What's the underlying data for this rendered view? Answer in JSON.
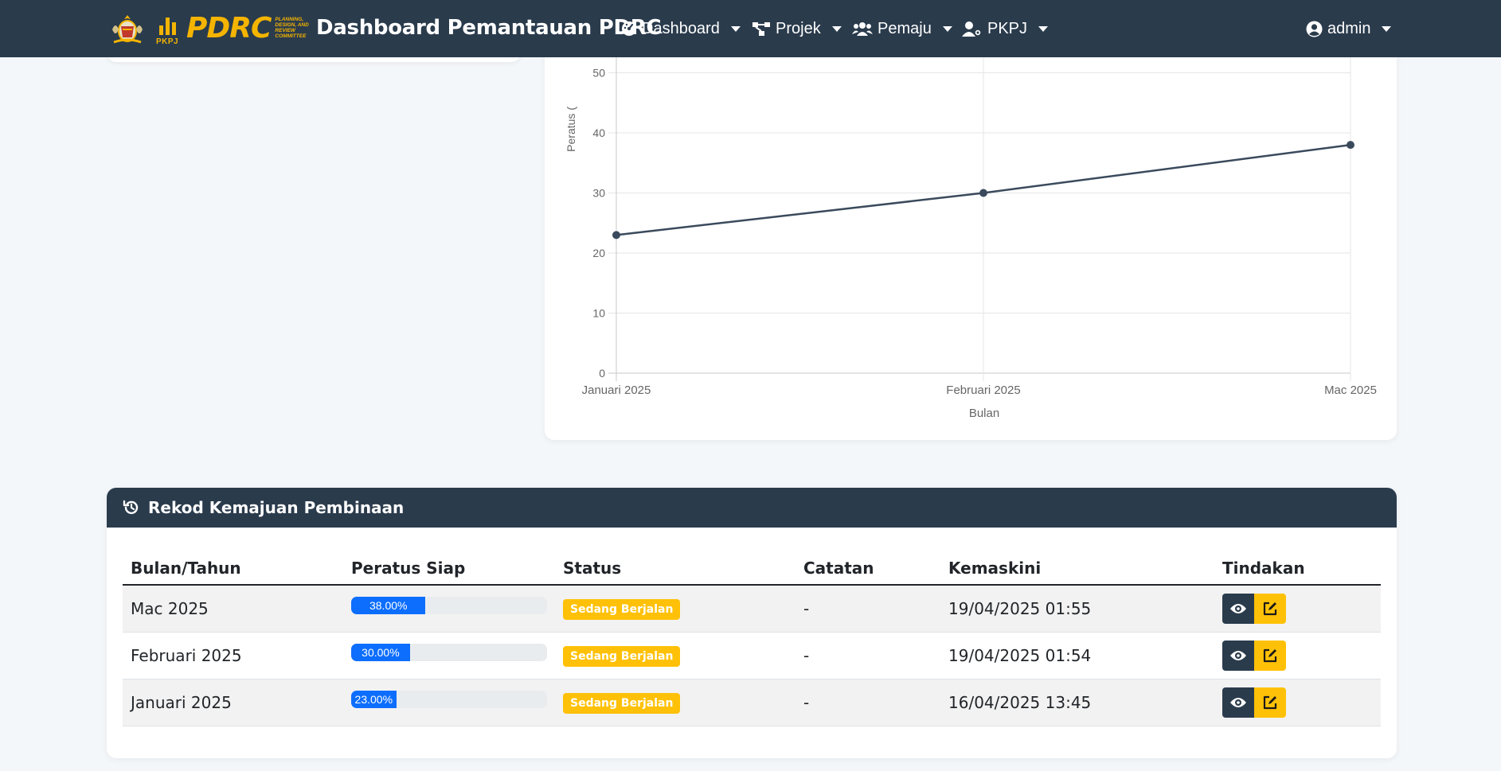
{
  "navbar": {
    "logo_pkpj": "PKPJ",
    "logo_pdrc": "PDRC",
    "logo_pdrc_sub": "PLANNING, DESIGN, AND REVIEW COMMITTEE",
    "title": "Dashboard Pemantauan PDRC",
    "menu": [
      {
        "label": "Dashboard",
        "icon": "gauge-icon"
      },
      {
        "label": "Projek",
        "icon": "project-diagram-icon"
      },
      {
        "label": "Pemaju",
        "icon": "users-icon"
      },
      {
        "label": "PKPJ",
        "icon": "user-gear-icon"
      }
    ],
    "user": {
      "label": "admin",
      "icon": "user-circle-icon"
    }
  },
  "chart_data": {
    "type": "line",
    "categories": [
      "Januari 2025",
      "Februari 2025",
      "Mac 2025"
    ],
    "values": [
      23,
      30,
      38
    ],
    "xlabel": "Bulan",
    "ylabel": "Peratus (",
    "y_ticks": [
      "0",
      "10",
      "20",
      "30",
      "40",
      "50"
    ],
    "ylim": [
      0,
      50
    ],
    "grid": true,
    "line_color": "#3a4a5c"
  },
  "records": {
    "title": "Rekod Kemajuan Pembinaan",
    "icon": "history-icon",
    "columns": [
      "Bulan/Tahun",
      "Peratus Siap",
      "Status",
      "Catatan",
      "Kemaskini",
      "Tindakan"
    ],
    "rows": [
      {
        "month": "Mac 2025",
        "percent": 38,
        "percent_label": "38.00%",
        "status": "Sedang Berjalan",
        "note": "-",
        "updated": "19/04/2025 01:55"
      },
      {
        "month": "Februari 2025",
        "percent": 30,
        "percent_label": "30.00%",
        "status": "Sedang Berjalan",
        "note": "-",
        "updated": "19/04/2025 01:54"
      },
      {
        "month": "Januari 2025",
        "percent": 23,
        "percent_label": "23.00%",
        "status": "Sedang Berjalan",
        "note": "-",
        "updated": "16/04/2025 13:45"
      }
    ]
  },
  "colors": {
    "navbar": "#2a3b4c",
    "accent": "#f4b400",
    "progress": "#0d6efd",
    "badge": "#ffc107"
  }
}
